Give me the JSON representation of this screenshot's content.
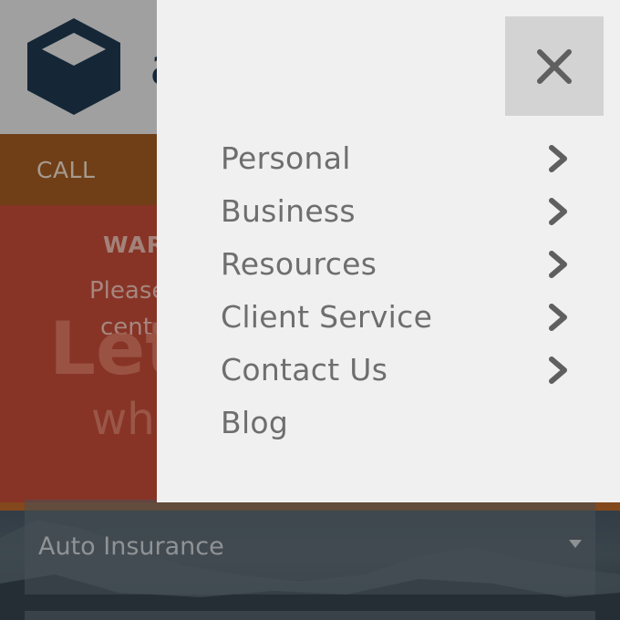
{
  "background_page": {
    "brand_fragment": "a",
    "call_label": "CALL",
    "warning_title": "WAR",
    "warning_line1": "Please",
    "warning_line2": "cente",
    "hero_big": "Let",
    "hero_sub": "wh",
    "insurance_select_value": "Auto Insurance"
  },
  "menu": {
    "items": [
      {
        "label": "Personal",
        "has_submenu": true
      },
      {
        "label": "Business",
        "has_submenu": true
      },
      {
        "label": "Resources",
        "has_submenu": true
      },
      {
        "label": "Client Service",
        "has_submenu": true
      },
      {
        "label": "Contact Us",
        "has_submenu": true
      },
      {
        "label": "Blog",
        "has_submenu": false
      }
    ],
    "close_icon": "close-icon",
    "submenu_icon": "chevron-right-icon"
  },
  "colors": {
    "header_bg": "#ececec",
    "call_bar": "#a55e23",
    "hero": "#c84d38",
    "drawer_bg": "#f0f0f0",
    "menu_text": "#6e6e6e",
    "logo": "#1f3a52"
  }
}
